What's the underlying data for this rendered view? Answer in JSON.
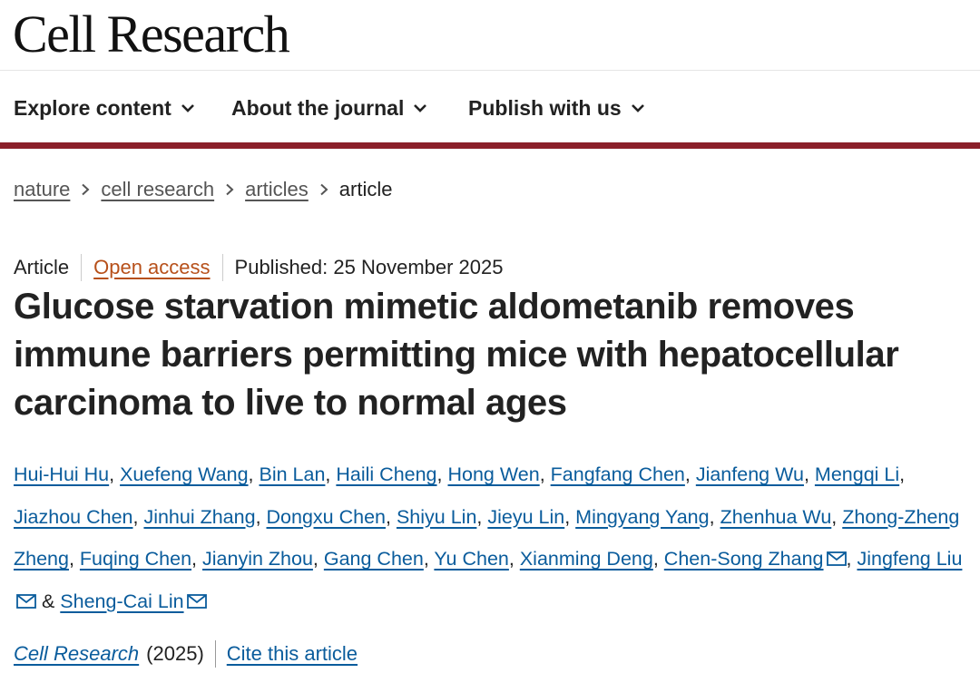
{
  "site": {
    "logo": "Cell Research"
  },
  "nav": {
    "items": [
      {
        "label": "Explore content"
      },
      {
        "label": "About the journal"
      },
      {
        "label": "Publish with us"
      }
    ],
    "accent_color": "#8b1f2a"
  },
  "breadcrumb": {
    "items": [
      "nature",
      "cell research",
      "articles"
    ],
    "current": "article"
  },
  "article": {
    "type": "Article",
    "access": "Open access",
    "published": "Published: 25 November 2025",
    "title": "Glucose starvation mimetic aldometanib removes immune barriers permitting mice with hepatocellular carcinoma to live to normal ages",
    "authors": [
      "Hui-Hui Hu",
      "Xuefeng Wang",
      "Bin Lan",
      "Haili Cheng",
      "Hong Wen",
      "Fangfang Chen",
      "Jianfeng Wu",
      "Mengqi Li",
      "Jiazhou Chen",
      "Jinhui Zhang",
      "Dongxu Chen",
      "Shiyu Lin",
      "Jieyu Lin",
      "Mingyang Yang",
      "Zhenhua Wu",
      "Zhong-Zheng Zheng",
      "Fuqing Chen",
      "Jianyin Zhou",
      "Gang Chen",
      "Yu Chen",
      "Xianming Deng",
      "Chen-Song Zhang",
      "Jingfeng Liu",
      "Sheng-Cai Lin"
    ],
    "author_separator": ", ",
    "author_ampersand": " & ",
    "link_color": "#0a5c9c",
    "open_access_color": "#b7501a"
  },
  "citation": {
    "journal": "Cell Research",
    "year": "(2025)",
    "cite_label": "Cite this article"
  },
  "icons": {
    "chevron": "chevron-down-icon",
    "breadcrumb_sep": "chevron-right-icon",
    "mail": "mail-icon"
  }
}
